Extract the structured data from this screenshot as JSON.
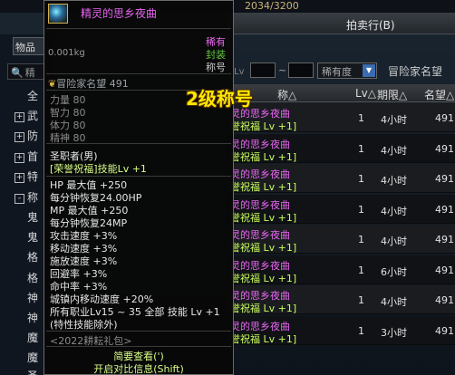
{
  "header": {
    "gold": "2034/3200",
    "auction_title": "拍卖行(B)"
  },
  "left": {
    "tab_label": "物品",
    "search_placeholder": "精",
    "categories": [
      {
        "box": "",
        "label": "全"
      },
      {
        "box": "+",
        "label": "武"
      },
      {
        "box": "+",
        "label": "防"
      },
      {
        "box": "+",
        "label": "首"
      },
      {
        "box": "+",
        "label": "特"
      },
      {
        "box": "-",
        "label": "称"
      },
      {
        "box": "",
        "label": "鬼"
      },
      {
        "box": "",
        "label": "鬼"
      },
      {
        "box": "",
        "label": "格"
      },
      {
        "box": "",
        "label": "格"
      },
      {
        "box": "",
        "label": "神"
      },
      {
        "box": "",
        "label": "神"
      },
      {
        "box": "",
        "label": "魔"
      },
      {
        "box": "",
        "label": "魔"
      },
      {
        "box": "",
        "label": "圣"
      }
    ]
  },
  "filters": {
    "lv_label": "Lv",
    "lv_min": "",
    "lv_max": "",
    "rarity_label": "稀有度",
    "adv_rep_button": "冒险家名望"
  },
  "table": {
    "columns": {
      "name": "称△",
      "lv": "Lv△",
      "period": "期限△",
      "reputation": "名望△"
    },
    "rows": [
      {
        "name": "灵的思乡夜曲",
        "bonus": "誉祝福 Lv +1]",
        "lv": "1",
        "period": "4小时",
        "reputation": "491"
      },
      {
        "name": "灵的思乡夜曲",
        "bonus": "誉祝福 Lv +1]",
        "lv": "1",
        "period": "4小时",
        "reputation": "491"
      },
      {
        "name": "灵的思乡夜曲",
        "bonus": "誉祝福 Lv +1]",
        "lv": "1",
        "period": "4小时",
        "reputation": "491"
      },
      {
        "name": "灵的思乡夜曲",
        "bonus": "誉祝福 Lv +1]",
        "lv": "1",
        "period": "4小时",
        "reputation": "491"
      },
      {
        "name": "灵的思乡夜曲",
        "bonus": "誉祝福 Lv +1]",
        "lv": "1",
        "period": "4小时",
        "reputation": "491"
      },
      {
        "name": "灵的思乡夜曲",
        "bonus": "誉祝福 Lv +1]",
        "lv": "1",
        "period": "6小时",
        "reputation": "491"
      },
      {
        "name": "灵的思乡夜曲",
        "bonus": "誉祝福 Lv +1]",
        "lv": "1",
        "period": "4小时",
        "reputation": "491"
      },
      {
        "name": "灵的思乡夜曲",
        "bonus": "誉祝福 Lv +1]",
        "lv": "1",
        "period": "3小时",
        "reputation": "491"
      }
    ]
  },
  "tooltip": {
    "name": "精灵的思乡夜曲",
    "weight": "0.001kg",
    "rarity": "稀有",
    "seal": "封装",
    "type": "称号",
    "adventurer_rep": "冒险家名望 491",
    "base_stats": [
      "力量 80",
      "智力 80",
      "体力 80",
      "精神 80"
    ],
    "class_req": "圣职者(男)",
    "skill_bonus": "[荣誉祝福]技能Lv +1",
    "effects": [
      "HP 最大值 +250",
      "每分钟恢复24.00HP",
      "MP 最大值 +250",
      "每分钟恢复24MP",
      "攻击速度 +3%",
      "移动速度 +3%",
      "施放速度 +3%",
      "回避率 +3%",
      "命中率 +3%",
      "城镇内移动速度 +20%",
      "所有职业Lv15 ~ 35 全部 技能 Lv +1",
      "(特性技能除外)"
    ],
    "package": "<2022耕耘礼包>",
    "footer_details": "简要查看(')",
    "footer_compare": "开启对比信息(Shift)"
  },
  "badge": "2级称号"
}
